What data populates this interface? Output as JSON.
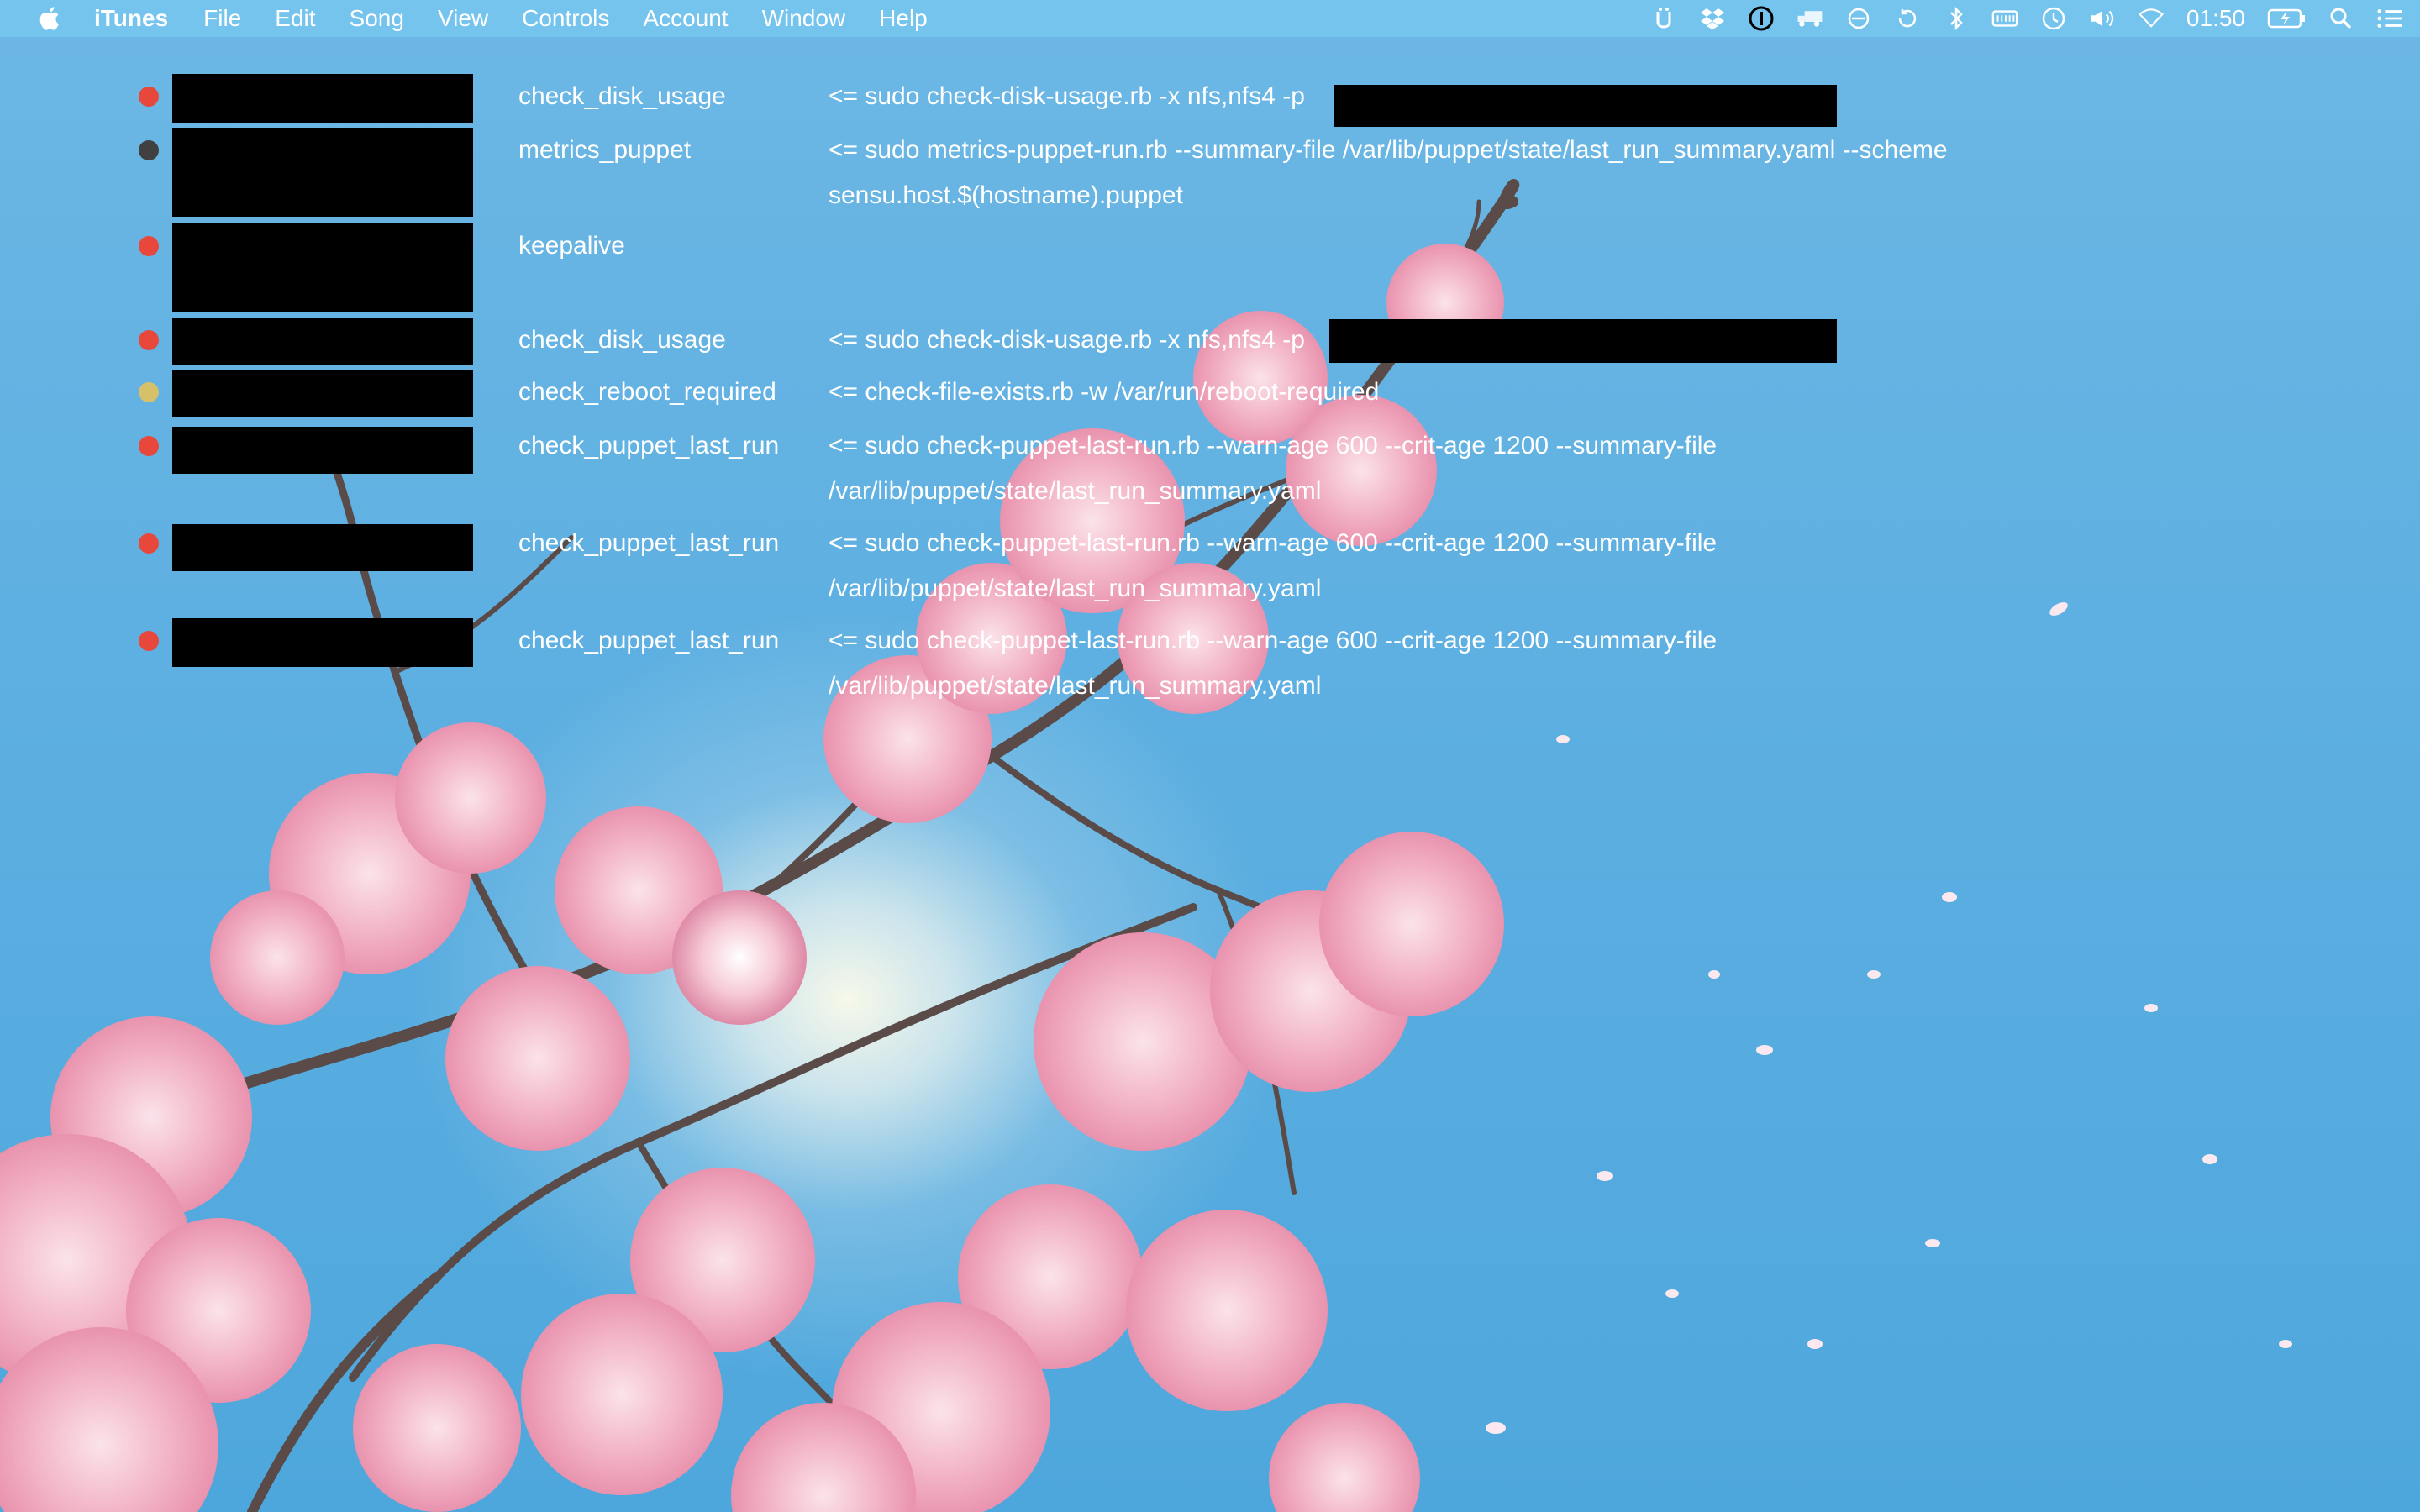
{
  "menubar": {
    "app_name": "iTunes",
    "menus": [
      "File",
      "Edit",
      "Song",
      "View",
      "Controls",
      "Account",
      "Window",
      "Help"
    ],
    "status_icons": [
      "utility-icon",
      "dropbox-icon",
      "onepassword-icon",
      "delivery-truck-icon",
      "sync-icon",
      "restore-icon",
      "bluetooth-icon",
      "keyboard-icon",
      "time-machine-icon",
      "volume-icon",
      "wifi-icon"
    ],
    "battery_icon": "battery-charging-icon",
    "clock": "01:50",
    "search_icon": "spotlight-icon",
    "list_icon": "notification-center-icon"
  },
  "colors": {
    "status_red": "#e8473c",
    "status_gray": "#404040",
    "status_yellow": "#d6c06a",
    "text": "#ffffff",
    "redaction": "#000000"
  },
  "checks": [
    {
      "status": "red",
      "name": "check_disk_usage",
      "command": "<= sudo check-disk-usage.rb -x nfs,nfs4 -p"
    },
    {
      "status": "gray",
      "name": "metrics_puppet",
      "command": "<= sudo metrics-puppet-run.rb --summary-file /var/lib/puppet/state/last_run_summary.yaml --scheme sensu.host.$(hostname).puppet"
    },
    {
      "status": "red",
      "name": "keepalive",
      "command": ""
    },
    {
      "status": "red",
      "name": "check_disk_usage",
      "command": "<= sudo check-disk-usage.rb -x nfs,nfs4 -p"
    },
    {
      "status": "yellow",
      "name": "check_reboot_required",
      "command": "<= check-file-exists.rb -w /var/run/reboot-required"
    },
    {
      "status": "red",
      "name": "check_puppet_last_run",
      "command": "<= sudo check-puppet-last-run.rb --warn-age 600 --crit-age 1200 --summary-file /var/lib/puppet/state/last_run_summary.yaml"
    },
    {
      "status": "red",
      "name": "check_puppet_last_run",
      "command": "<= sudo check-puppet-last-run.rb --warn-age 600 --crit-age 1200 --summary-file /var/lib/puppet/state/last_run_summary.yaml"
    },
    {
      "status": "red",
      "name": "check_puppet_last_run",
      "command": "<= sudo check-puppet-last-run.rb --warn-age 600 --crit-age 1200 --summary-file /var/lib/puppet/state/last_run_summary.yaml"
    }
  ]
}
